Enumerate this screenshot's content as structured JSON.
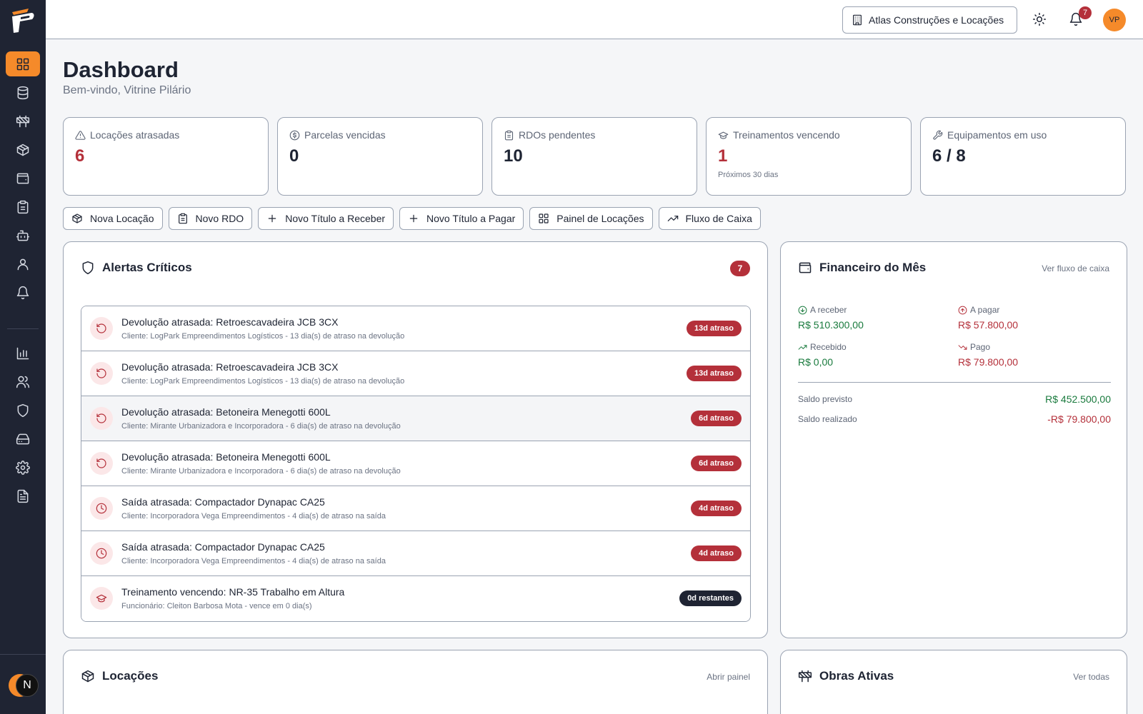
{
  "topbar": {
    "company": "Atlas Construções e Locações",
    "notification_count": "7",
    "avatar_initials": "VP"
  },
  "sidebar": {
    "user_initial": "N",
    "items": [
      {
        "name": "dashboard",
        "icon": "layout-dashboard-icon",
        "active": true
      },
      {
        "name": "database",
        "icon": "database-icon"
      },
      {
        "name": "obras",
        "icon": "construction-icon"
      },
      {
        "name": "locacoes",
        "icon": "package-icon"
      },
      {
        "name": "financeiro",
        "icon": "wallet-icon"
      },
      {
        "name": "rdos",
        "icon": "clipboard-icon"
      },
      {
        "name": "robo",
        "icon": "bot-icon"
      },
      {
        "name": "usuario",
        "icon": "user-icon"
      },
      {
        "name": "notificacoes",
        "icon": "bell-icon"
      },
      {
        "name": "relatorios",
        "icon": "bar-chart-icon"
      },
      {
        "name": "equipe",
        "icon": "users-icon"
      },
      {
        "name": "seguranca",
        "icon": "shield-icon"
      },
      {
        "name": "armazenamento",
        "icon": "hard-drive-icon"
      },
      {
        "name": "configuracoes",
        "icon": "gear-icon"
      },
      {
        "name": "documentos",
        "icon": "file-text-icon"
      }
    ]
  },
  "header": {
    "title": "Dashboard",
    "subtitle": "Bem-vindo, Vitrine Pilário"
  },
  "kpis": [
    {
      "label": "Locações atrasadas",
      "value": "6",
      "icon": "alert-triangle-icon",
      "red": true
    },
    {
      "label": "Parcelas vencidas",
      "value": "0",
      "icon": "dollar-circle-icon"
    },
    {
      "label": "RDOs pendentes",
      "value": "10",
      "icon": "clipboard-icon"
    },
    {
      "label": "Treinamentos vencendo",
      "value": "1",
      "note": "Próximos 30 dias",
      "icon": "graduation-cap-icon",
      "red": true
    },
    {
      "label": "Equipamentos em uso",
      "value": "6 / 8",
      "icon": "wrench-icon"
    }
  ],
  "actions": [
    {
      "label": "Nova Locação",
      "icon": "package-icon"
    },
    {
      "label": "Novo RDO",
      "icon": "clipboard-icon"
    },
    {
      "label": "Novo Título a Receber",
      "icon": "plus-icon"
    },
    {
      "label": "Novo Título a Pagar",
      "icon": "plus-icon"
    },
    {
      "label": "Painel de Locações",
      "icon": "layout-dashboard-icon"
    },
    {
      "label": "Fluxo de Caixa",
      "icon": "trending-up-icon"
    }
  ],
  "alerts": {
    "title": "Alertas Críticos",
    "count": "7",
    "items": [
      {
        "title": "Devolução atrasada: Retroescavadeira JCB 3CX",
        "desc": "Cliente: LogPark Empreendimentos Logísticos - 13 dia(s) de atraso na devolução",
        "badge": "13d atraso",
        "icon": "rotate-ccw-icon"
      },
      {
        "title": "Devolução atrasada: Retroescavadeira JCB 3CX",
        "desc": "Cliente: LogPark Empreendimentos Logísticos - 13 dia(s) de atraso na devolução",
        "badge": "13d atraso",
        "icon": "rotate-ccw-icon"
      },
      {
        "title": "Devolução atrasada: Betoneira Menegotti 600L",
        "desc": "Cliente: Mirante Urbanizadora e Incorporadora - 6 dia(s) de atraso na devolução",
        "badge": "6d atraso",
        "icon": "rotate-ccw-icon",
        "highlight": true
      },
      {
        "title": "Devolução atrasada: Betoneira Menegotti 600L",
        "desc": "Cliente: Mirante Urbanizadora e Incorporadora - 6 dia(s) de atraso na devolução",
        "badge": "6d atraso",
        "icon": "rotate-ccw-icon"
      },
      {
        "title": "Saída atrasada: Compactador Dynapac CA25",
        "desc": "Cliente: Incorporadora Vega Empreendimentos - 4 dia(s) de atraso na saída",
        "badge": "4d atraso",
        "icon": "clock-icon"
      },
      {
        "title": "Saída atrasada: Compactador Dynapac CA25",
        "desc": "Cliente: Incorporadora Vega Empreendimentos - 4 dia(s) de atraso na saída",
        "badge": "4d atraso",
        "icon": "clock-icon"
      },
      {
        "title": "Treinamento vencendo: NR-35 Trabalho em Altura",
        "desc": "Funcionário: Cleiton Barbosa Mota - vence em 0 dia(s)",
        "badge": "0d restantes",
        "icon": "graduation-cap-icon",
        "dark": true
      }
    ]
  },
  "finance": {
    "title": "Financeiro do Mês",
    "link": "Ver fluxo de caixa",
    "receber_label": "A receber",
    "receber_value": "R$ 510.300,00",
    "pagar_label": "A pagar",
    "pagar_value": "R$ 57.800,00",
    "recebido_label": "Recebido",
    "recebido_value": "R$ 0,00",
    "pago_label": "Pago",
    "pago_value": "R$ 79.800,00",
    "saldo_previsto_label": "Saldo previsto",
    "saldo_previsto_value": "R$ 452.500,00",
    "saldo_realizado_label": "Saldo realizado",
    "saldo_realizado_value": "-R$ 79.800,00"
  },
  "locacoes": {
    "title": "Locações",
    "link": "Abrir painel"
  },
  "obras": {
    "title": "Obras Ativas",
    "link": "Ver todas"
  },
  "colors": {
    "accent": "#f58a2a",
    "sidebar": "#1f2433",
    "danger": "#b4303a",
    "success": "#197a3d"
  }
}
